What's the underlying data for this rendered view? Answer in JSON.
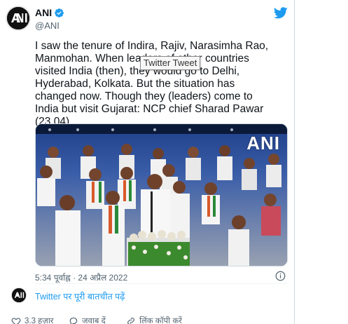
{
  "author": {
    "name": "ANI",
    "handle": "@ANI",
    "avatar_icon": "ani-logo-icon",
    "verified_icon": "verified-badge-icon",
    "brand_color": "#1d9bf0"
  },
  "tweet": {
    "text": "I saw the tenure of Indira, Rajiv, Narasimha Rao, Manmohan. When leaders of other countries visited India (then), they would go to Delhi, Hyderabad, Kolkata. But the situation has changed now. Though they (leaders) come to India but visit Gujarat: NCP chief Sharad Pawar (23.04)",
    "tooltip": "Twitter Tweet",
    "media": {
      "watermark": "ANI"
    },
    "timestamp": "5:34 पूर्वाह्न · 24 अप्रैल 2022"
  },
  "conversation": {
    "link_text": "Twitter पर पूरी बातचीत पढ़ें"
  },
  "actions": {
    "like_count": "3.3 हज़ार",
    "reply_label": "जवाब दें",
    "copy_link_label": "लिंक कॉपी करें"
  },
  "icons": {
    "twitter": "twitter-bird-icon",
    "info": "info-icon",
    "heart": "heart-icon",
    "reply": "reply-icon",
    "link": "link-icon"
  }
}
